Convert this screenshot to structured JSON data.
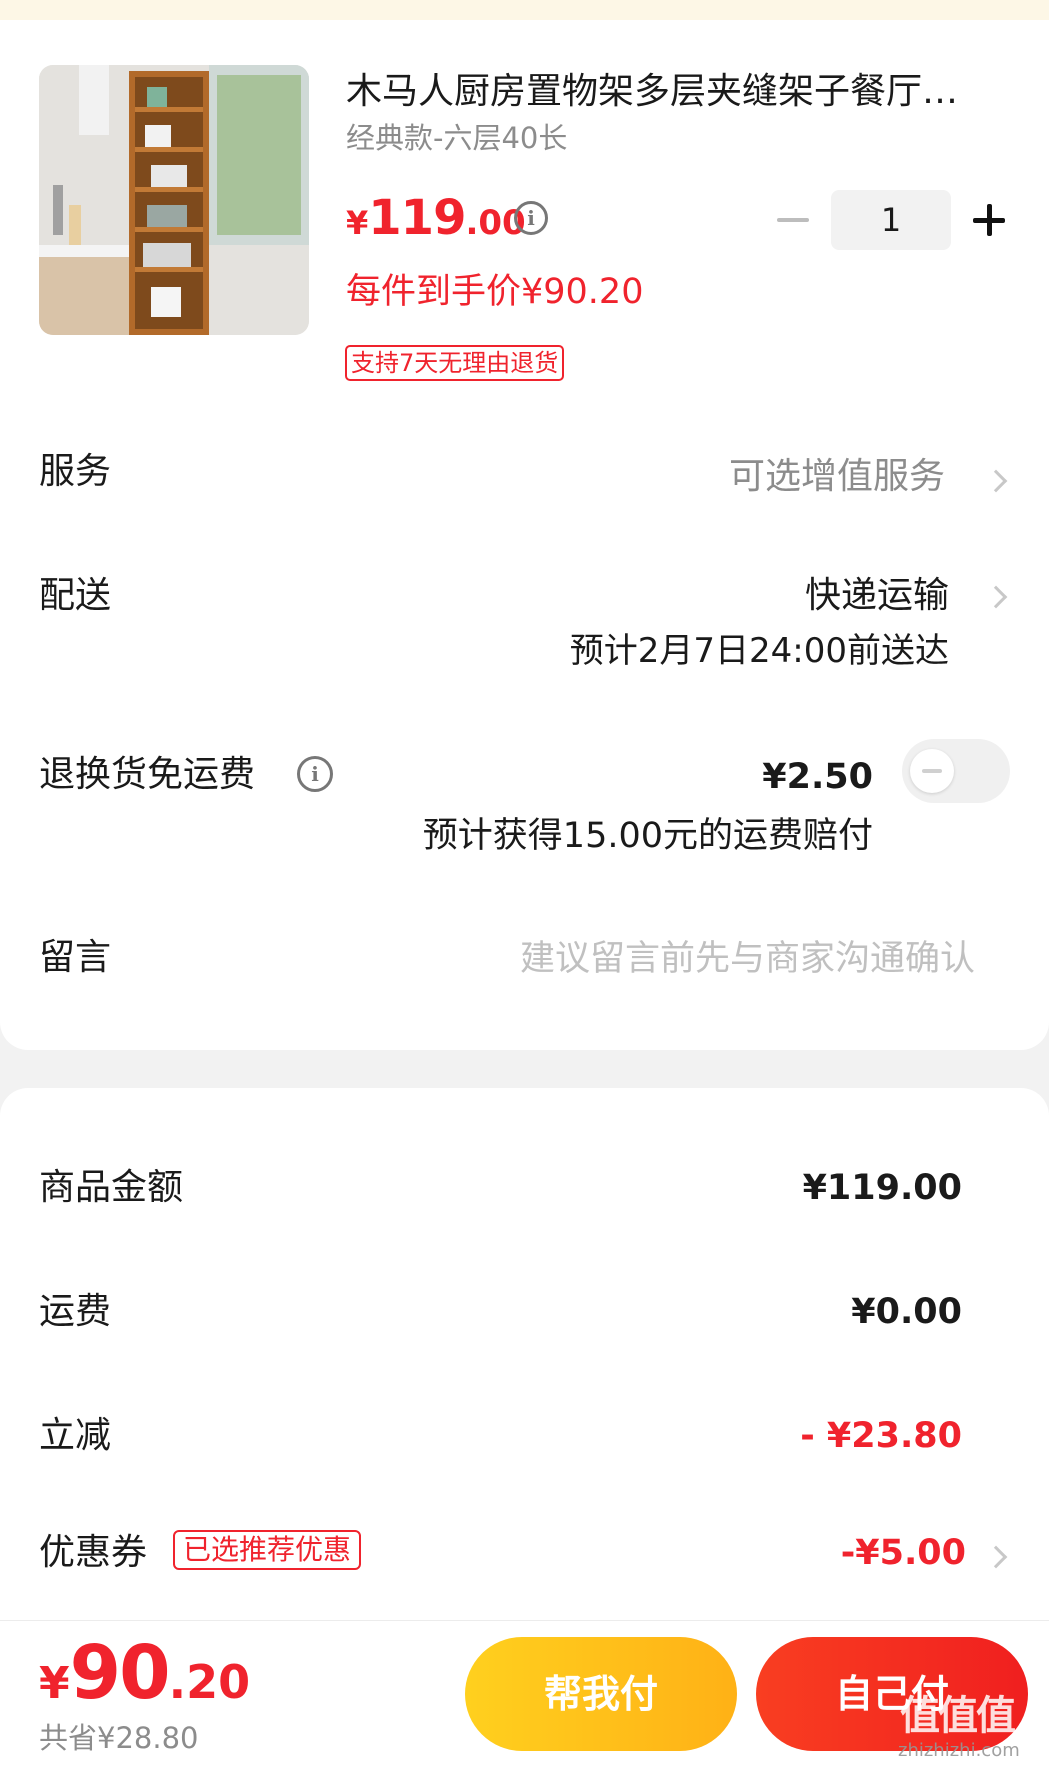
{
  "product": {
    "title": "木马人厨房置物架多层夹缝架子餐厅…",
    "spec": "经典款-六层40长",
    "price_currency": "¥",
    "price_integer": "119",
    "price_decimal": ".00",
    "unit_price": "每件到手价¥90.20",
    "return_badge": "支持7天无理由退货",
    "quantity": "1"
  },
  "service": {
    "label": "服务",
    "value": "可选增值服务"
  },
  "delivery": {
    "label": "配送",
    "method": "快递运输",
    "eta": "预计2月7日24:00前送达"
  },
  "return_freight": {
    "label": "退换货免运费",
    "price": "¥2.50",
    "note": "预计获得15.00元的运费赔付",
    "enabled": false
  },
  "message": {
    "label": "留言",
    "placeholder": "建议留言前先与商家沟通确认",
    "value": ""
  },
  "summary": {
    "goods_label": "商品金额",
    "goods_value": "¥119.00",
    "shipping_label": "运费",
    "shipping_value": "¥0.00",
    "discount_label": "立减",
    "discount_value": "- ¥23.80",
    "coupon_label": "优惠券",
    "coupon_badge": "已选推荐优惠",
    "coupon_value": "-¥5.00"
  },
  "footer": {
    "total_currency": "¥",
    "total_integer": "90",
    "total_decimal": ".20",
    "saved": "共省¥28.80",
    "help_pay": "帮我付",
    "self_pay": "自己付"
  },
  "watermark": {
    "logo": "值值值",
    "url": "zhizhizhi.com"
  },
  "colors": {
    "accent_red": "#f0232d",
    "help_pay_yellow": "#ffc11a",
    "self_pay_red": "#f5301f",
    "muted_gray": "#8c8c8c"
  },
  "icons": [
    "info-icon",
    "chevron-right-icon",
    "minus-icon",
    "plus-icon",
    "toggle-switch"
  ]
}
